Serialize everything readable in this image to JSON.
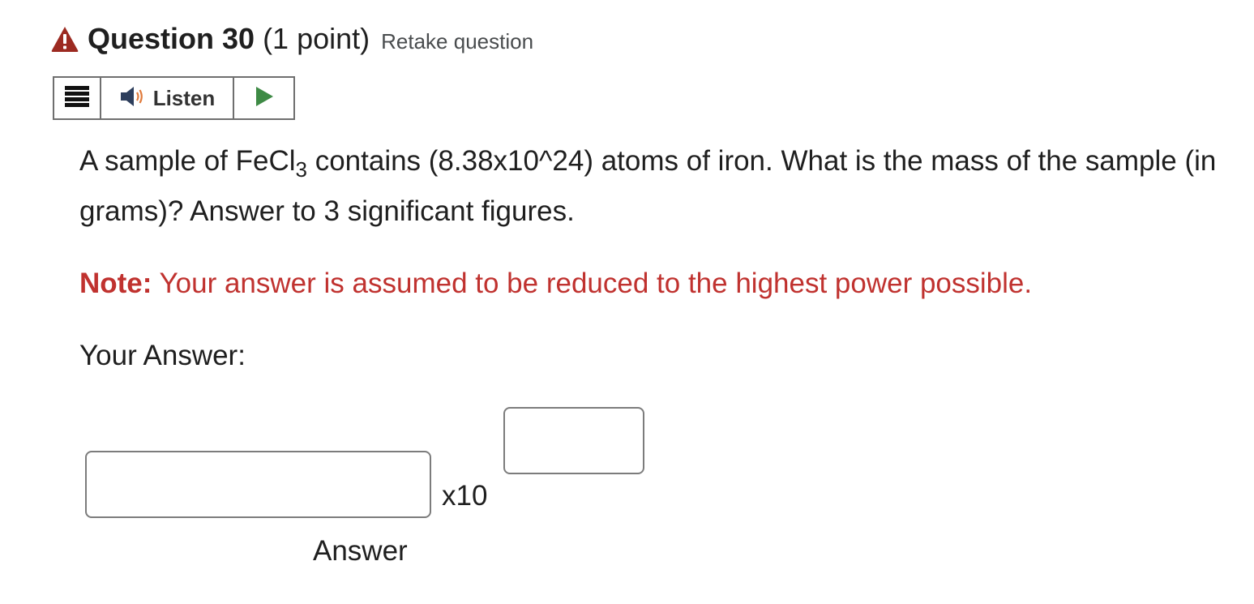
{
  "question": {
    "title": "Question 30",
    "points": "(1 point)",
    "retake_label": "Retake question",
    "status_icon": "warning-triangle-icon",
    "status_color": "#9c2a21"
  },
  "toolbar": {
    "menu_icon": "hamburger-menu-icon",
    "listen_icon": "speaker-icon",
    "listen_label": "Listen",
    "play_icon": "play-icon",
    "play_color": "#3e8a45"
  },
  "content": {
    "text_before_formula": "A sample of FeCl",
    "formula_subscript": "3",
    "text_after_formula": " contains (8.38x10^24) atoms of iron.  What is the mass of the sample (in grams)? Answer to 3 significant figures.",
    "note_label": "Note:",
    "note_text": " Your answer is assumed to be reduced to the highest power possible.",
    "note_color": "#c0322f",
    "your_answer_label": "Your Answer:"
  },
  "answer": {
    "value": "",
    "times_ten_label": "x10",
    "exponent_value": "",
    "answer_caption": "Answer"
  }
}
